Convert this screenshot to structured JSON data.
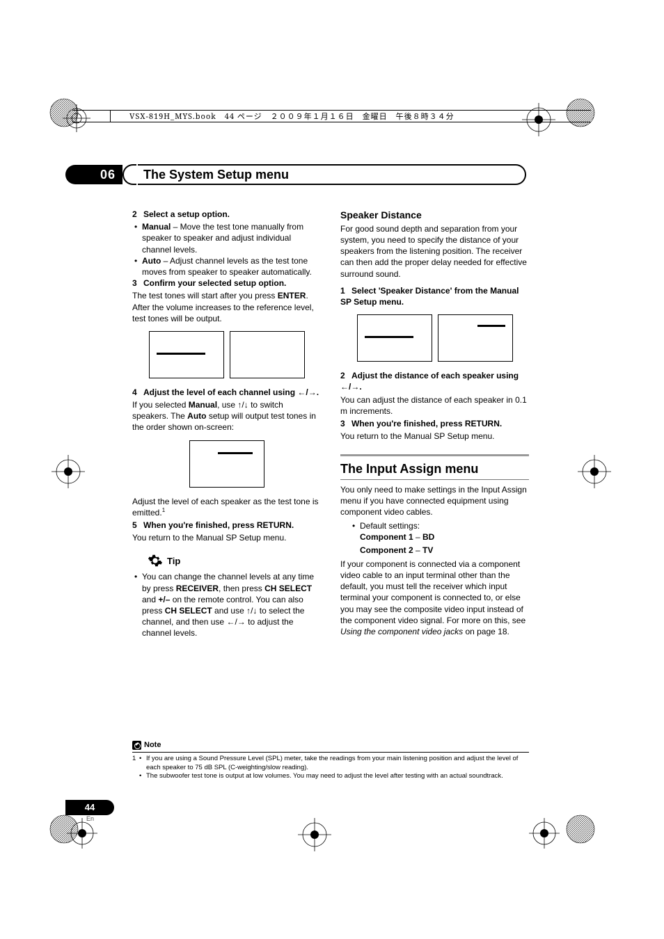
{
  "header_meta": "VSX-819H_MYS.book　44 ページ　２００９年１月１６日　金曜日　午後８時３４分",
  "chapter": {
    "number": "06",
    "title": "The System Setup menu"
  },
  "left": {
    "step2": {
      "num": "2",
      "title": "Select a setup option."
    },
    "manual_label": "Manual",
    "manual_text": " – Move the test tone manually from speaker to speaker and adjust individual channel levels.",
    "auto_label": "Auto",
    "auto_text": " – Adjust channel levels as the test tone moves from speaker to speaker automatically.",
    "step3": {
      "num": "3",
      "title": "Confirm your selected setup option."
    },
    "step3_body_a": "The test tones will start after you press ",
    "enter": "ENTER",
    "step3_body_b": ". After the volume increases to the reference level, test tones will be output.",
    "step4": {
      "num": "4",
      "title_a": "Adjust the level of each channel using ",
      "arrows": "←/→",
      "title_b": "."
    },
    "step4_body_a": "If you selected ",
    "manual2": "Manual",
    "step4_body_b": ", use ",
    "updown": "↑/↓",
    "step4_body_c": " to switch speakers. The ",
    "auto2": "Auto",
    "step4_body_d": " setup will output test tones in the order shown on-screen:",
    "adjust_line": "Adjust the level of each speaker as the test tone is emitted.",
    "fn_ref": "1",
    "step5": {
      "num": "5",
      "title": "When you're finished, press RETURN."
    },
    "step5_body": "You return to the Manual SP Setup menu.",
    "tip_label": "Tip",
    "tip_body_a": "You can change the channel levels at any time by press ",
    "receiver": "RECEIVER",
    "tip_body_b": ", then press ",
    "chselect": "CH SELECT",
    "tip_body_c": " and ",
    "plusminus": "+/–",
    "tip_body_d": " on the remote control. You can also press ",
    "chselect2": "CH SELECT",
    "tip_body_e": " and use ",
    "updown2": "↑/↓",
    "tip_body_f": " to select the channel, and then use ",
    "leftright2": "←/→",
    "tip_body_g": " to adjust the channel levels."
  },
  "right": {
    "spk_h": "Speaker Distance",
    "spk_p": "For good sound depth and separation from your system, you need to specify the distance of your speakers from the listening position. The receiver can then add the proper delay needed for effective surround sound.",
    "s1": {
      "num": "1",
      "title": "Select 'Speaker Distance' from the Manual SP Setup menu."
    },
    "s2": {
      "num": "2",
      "title_a": "Adjust the distance of each speaker using ",
      "arrows": "←/→",
      "title_b": "."
    },
    "s2_body": "You can adjust the distance of each speaker in 0.1 m increments.",
    "s3": {
      "num": "3",
      "title": "When you're finished, press RETURN."
    },
    "s3_body": "You return to the Manual SP Setup menu.",
    "ia_h": "The Input Assign menu",
    "ia_p1": "You only need to make settings in the Input Assign menu if you have connected equipment using component video cables.",
    "ia_def_label": "Default settings:",
    "ia_c1a": "Component 1",
    "ia_dash": " – ",
    "ia_c1b": "BD",
    "ia_c2a": "Component 2",
    "ia_c2b": "TV",
    "ia_p2_a": "If your component is connected via a component video cable to an input terminal other than the default, you must tell the receiver which input terminal your component is connected to, or else you may see the composite video input instead of the component video signal. For more on this, see ",
    "ia_p2_i": "Using the component video jacks",
    "ia_p2_b": " on page 18."
  },
  "footnote": {
    "note": "Note",
    "k": "1",
    "a": "If you are using a Sound Pressure Level (SPL) meter, take the readings from your main listening position and adjust the level of each speaker to 75 dB SPL (C-weighting/slow reading).",
    "b": "The subwoofer test tone is output at low volumes. You may need to adjust the level after testing with an actual soundtrack."
  },
  "page": {
    "num": "44",
    "lang": "En"
  }
}
